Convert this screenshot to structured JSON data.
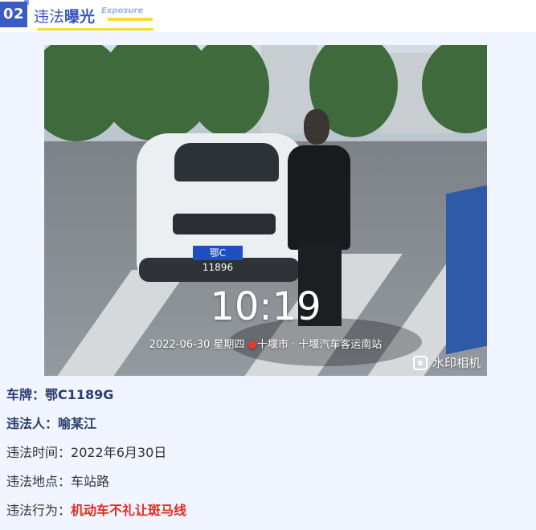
{
  "header": {
    "number": "02",
    "title_normal": "违法",
    "title_bold": "曝光",
    "tag": "Exposure"
  },
  "photo": {
    "time": "10:19",
    "date": "2022-06-30",
    "weekday": "星期四",
    "location": "十堰市 · 十堰汽车客运南站",
    "plate_text": "鄂C 11896",
    "watermark_text": "水印相机",
    "watermark_icon": "camera-app-icon",
    "pin_icon": "location-pin-icon"
  },
  "info": {
    "plate_label": "车牌：",
    "plate_value": "鄂C1189G",
    "violator_label": "违法人：",
    "violator_value": "喻某江",
    "time_label": "违法时间：",
    "time_value": "2022年6月30日",
    "place_label": "违法地点：",
    "place_value": "车站路",
    "behavior_label": "违法行为：",
    "behavior_value": "机动车不礼让斑马线"
  },
  "colors": {
    "accent": "#3a57b8",
    "badge": "#3b5bc6",
    "highlight": "#f6dc3a",
    "panel": "#f1f5ff",
    "violation_red": "#e22b1f"
  }
}
